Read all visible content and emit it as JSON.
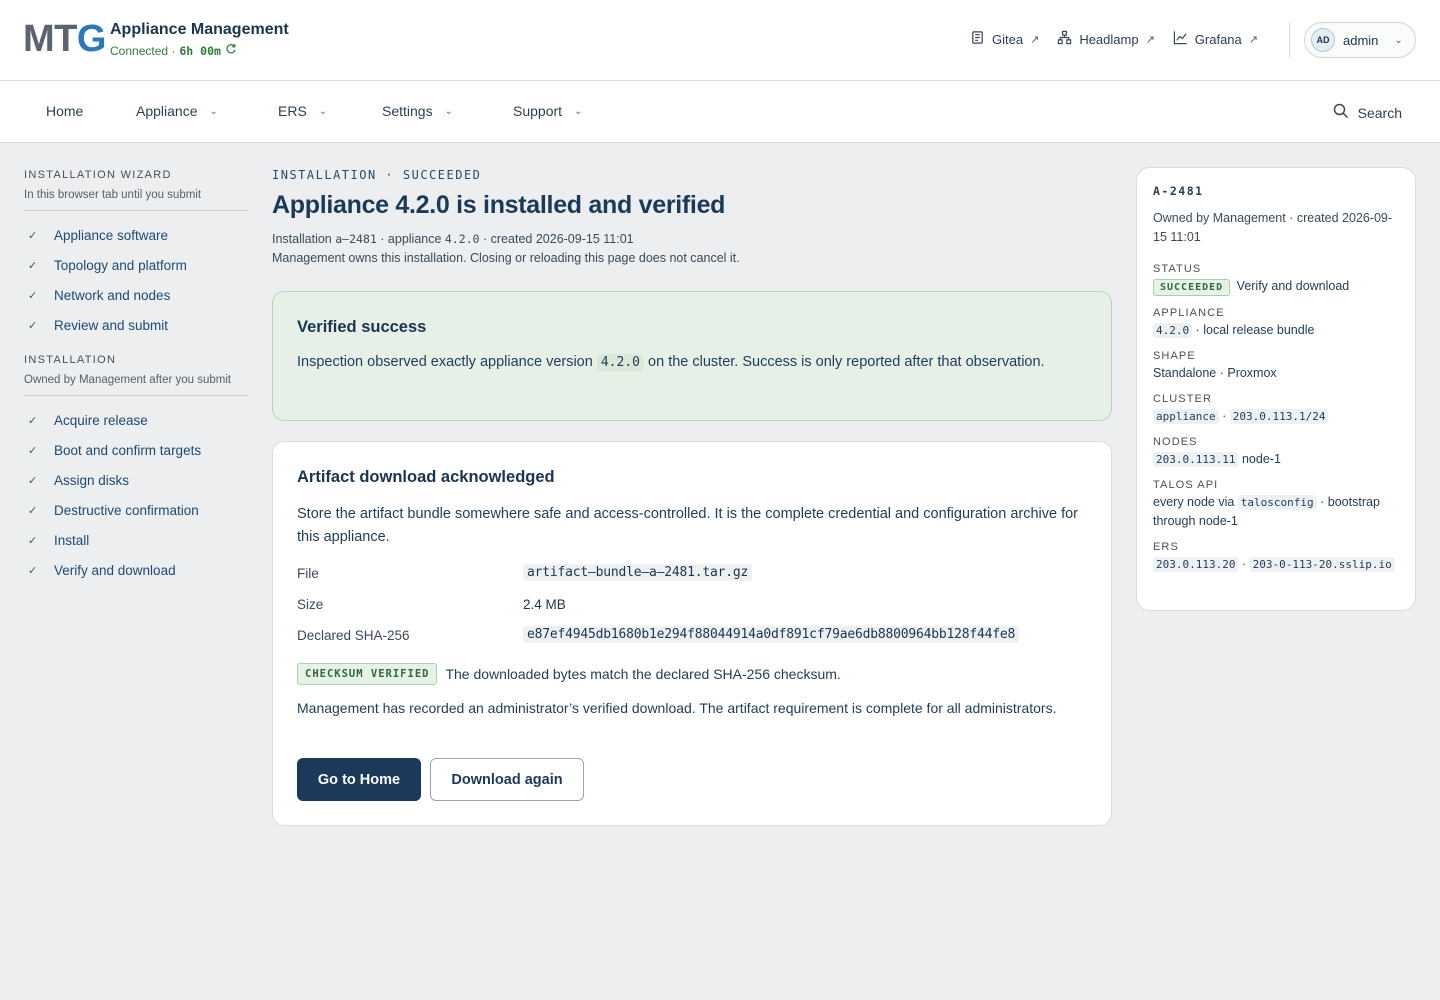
{
  "header": {
    "logo_text": "MTG",
    "app_title": "Appliance Management",
    "connection_status": "Connected ·",
    "uptime": "6h 00m",
    "links": [
      {
        "label": "Gitea",
        "icon": "document-icon"
      },
      {
        "label": "Headlamp",
        "icon": "topology-icon"
      },
      {
        "label": "Grafana",
        "icon": "chart-line-icon"
      }
    ],
    "external_arrow": "↗",
    "user": {
      "initials": "AD",
      "name": "admin"
    }
  },
  "nav": {
    "items": [
      {
        "label": "Home",
        "dropdown": false
      },
      {
        "label": "Appliance",
        "dropdown": true
      },
      {
        "label": "ERS",
        "dropdown": true
      },
      {
        "label": "Settings",
        "dropdown": true
      },
      {
        "label": "Support",
        "dropdown": true
      }
    ],
    "search_label": "Search"
  },
  "sidebar": {
    "wizard": {
      "heading": "INSTALLATION WIZARD",
      "subtitle": "In this browser tab until you submit",
      "steps": [
        "Appliance software",
        "Topology and platform",
        "Network and nodes",
        "Review and submit"
      ]
    },
    "installation": {
      "heading": "INSTALLATION",
      "subtitle": "Owned by Management after you submit",
      "steps": [
        "Acquire release",
        "Boot and confirm targets",
        "Assign disks",
        "Destructive confirmation",
        "Install",
        "Verify and download"
      ]
    },
    "check_glyph": "✓"
  },
  "main": {
    "eyebrow": "INSTALLATION · SUCCEEDED",
    "title": "Appliance 4.2.0 is installed and verified",
    "meta": {
      "installation_label": "Installation",
      "installation_id": "a–2481",
      "appliance_label": "· appliance",
      "version": "4.2.0",
      "created": "· created 2026-09-15 11:01"
    },
    "note": "Management owns this installation. Closing or reloading this page does not cancel it.",
    "success": {
      "title": "Verified success",
      "text_before": "Inspection observed exactly appliance version",
      "version": "4.2.0",
      "text_after": "on the cluster. Success is only reported after that observation."
    },
    "artifact": {
      "title": "Artifact download acknowledged",
      "text": "Store the artifact bundle somewhere safe and access-controlled. It is the complete credential and configuration archive for this appliance.",
      "file_label": "File",
      "file_value": "artifact–bundle–a–2481.tar.gz",
      "size_label": "Size",
      "size_value": "2.4 MB",
      "sha_label": "Declared SHA-256",
      "sha_value": "e87ef4945db1680b1e294f88044914a0df891cf79ae6db8800964bb128f44fe8",
      "badge": "CHECKSUM VERIFIED",
      "verify_text": "The downloaded bytes match the declared SHA-256 checksum.",
      "recorded_text": "Management has recorded an administrator’s verified download. The artifact requirement is complete for all administrators.",
      "primary_button": "Go to Home",
      "secondary_button": "Download again"
    }
  },
  "summary": {
    "id": "A-2481",
    "owner": "Owned by Management · created 2026-09-15 11:01",
    "status_label": "STATUS",
    "status_badge": "SUCCEEDED",
    "status_text": "Verify and download",
    "appliance_label": "APPLIANCE",
    "appliance_version": "4.2.0",
    "appliance_text": "· local release bundle",
    "shape_label": "SHAPE",
    "shape_value": "Standalone · Proxmox",
    "cluster_label": "CLUSTER",
    "cluster_name": "appliance",
    "cluster_sep": "·",
    "cluster_cidr": "203.0.113.1/24",
    "nodes_label": "NODES",
    "node_ip": "203.0.113.11",
    "node_name": "node-1",
    "talos_label": "TALOS API",
    "talos_before": "every node via",
    "talos_chip": "talosconfig",
    "talos_after": "· bootstrap through node-1",
    "ers_label": "ERS",
    "ers_ip": "203.0.113.20",
    "ers_sep": "·",
    "ers_host": "203-0-113-20.sslip.io"
  },
  "colors": {
    "brand_navy": "#1b3a5a",
    "logo_accent": "#2e77b8",
    "success_green": "#2f7d3c",
    "success_bg": "#e6f0e6",
    "page_bg": "#eceeef"
  }
}
